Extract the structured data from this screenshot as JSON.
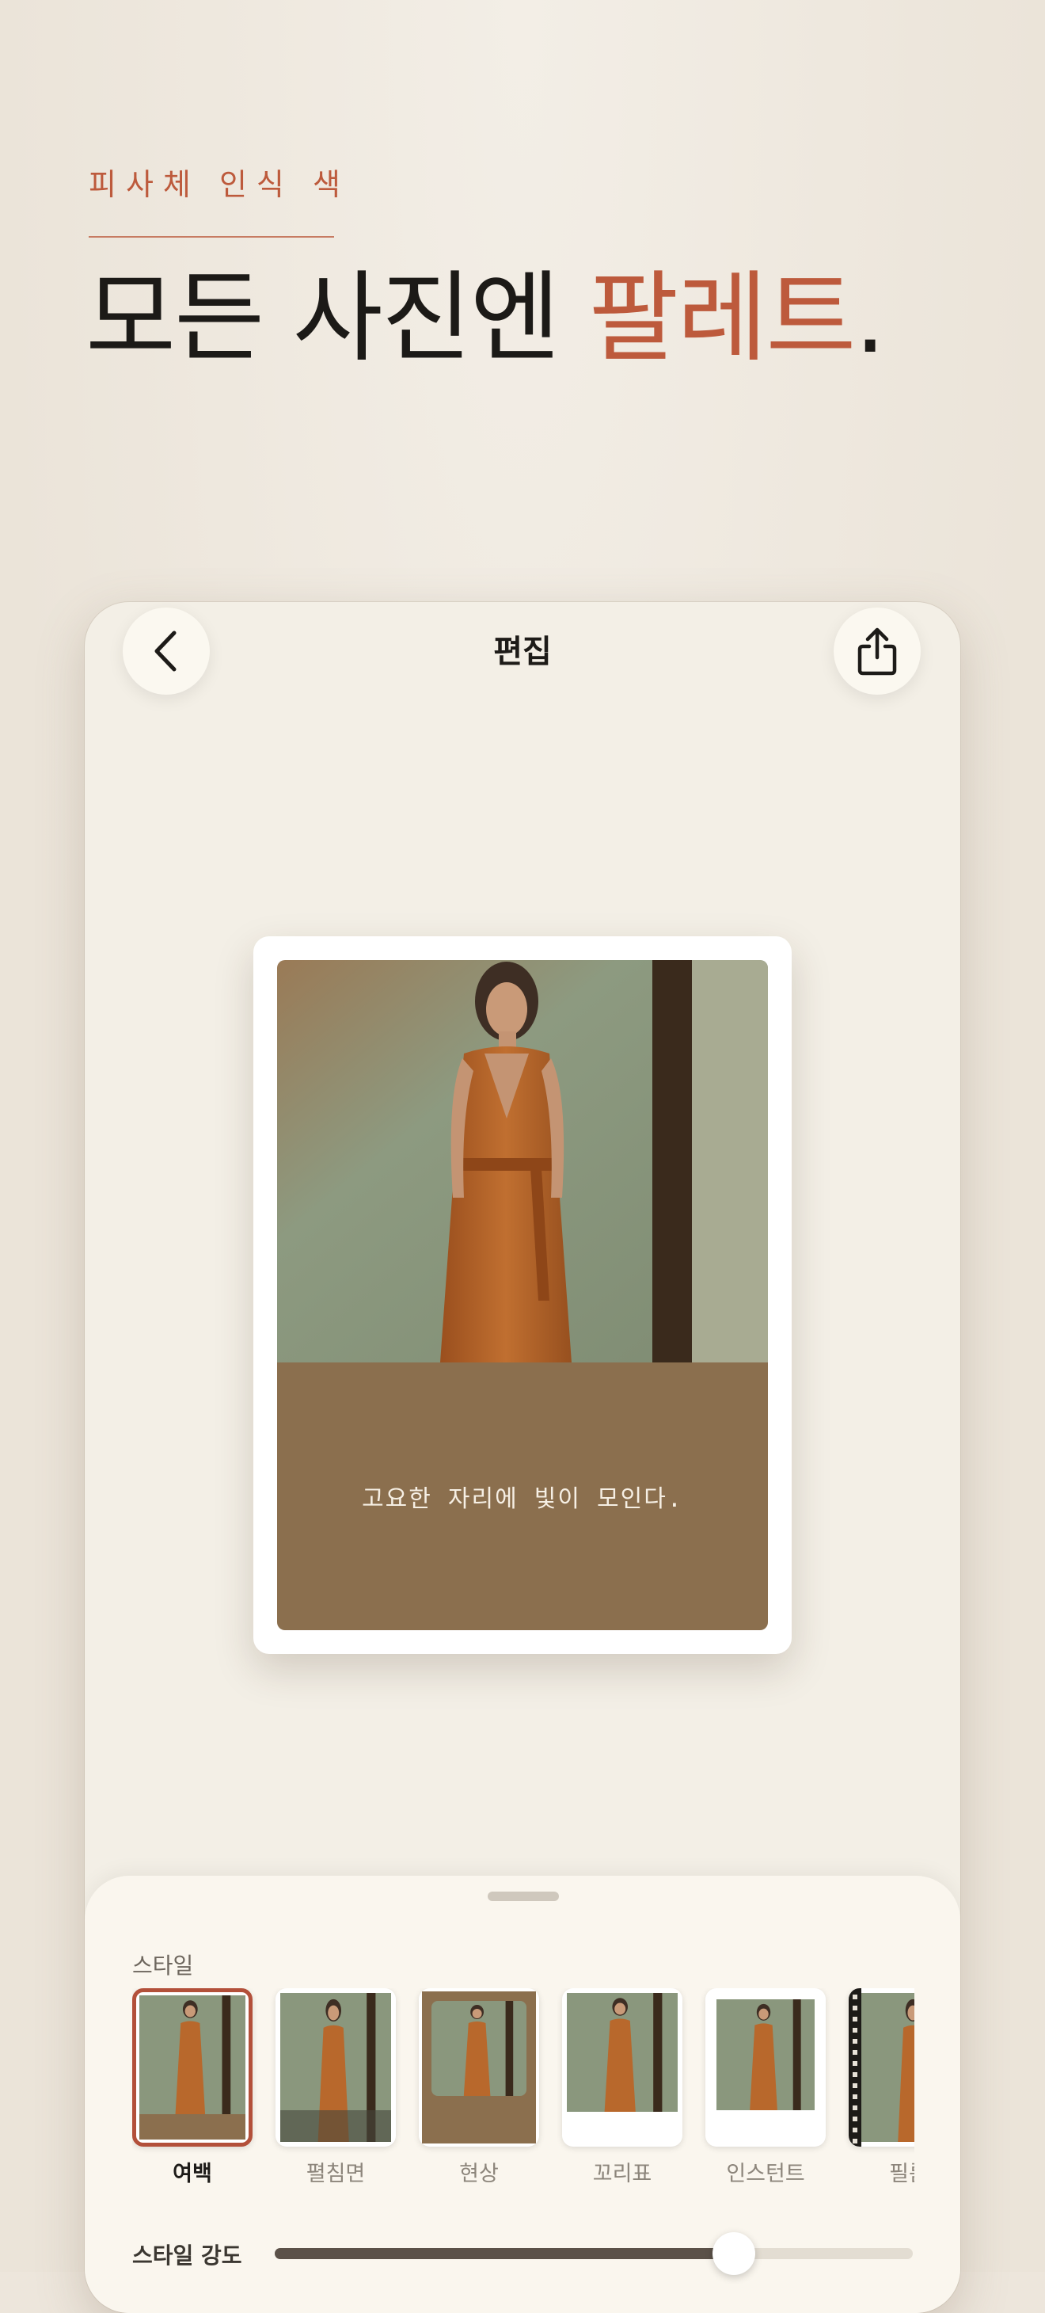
{
  "hero": {
    "eyebrow": "피사체 인식 색",
    "headline_main": "모든 사진엔 ",
    "headline_accent": "팔레트",
    "headline_end": "."
  },
  "editor": {
    "title": "편집",
    "back_icon": "chevron-left-icon",
    "share_icon": "share-icon"
  },
  "card": {
    "caption": "고요한 자리에 빛이 모인다."
  },
  "sheet": {
    "style_label": "스타일",
    "styles": [
      {
        "name": "여백",
        "selected": true
      },
      {
        "name": "펼침면",
        "selected": false
      },
      {
        "name": "현상",
        "selected": false
      },
      {
        "name": "꼬리표",
        "selected": false
      },
      {
        "name": "인스턴트",
        "selected": false
      },
      {
        "name": "필름",
        "selected": false
      }
    ],
    "strength_label": "스타일 강도",
    "strength_value": 0.72
  },
  "colors": {
    "accent": "#bd5a3c",
    "band": "#8b6f4e",
    "dress": "#b8682c",
    "wall": "#8c9a80"
  }
}
